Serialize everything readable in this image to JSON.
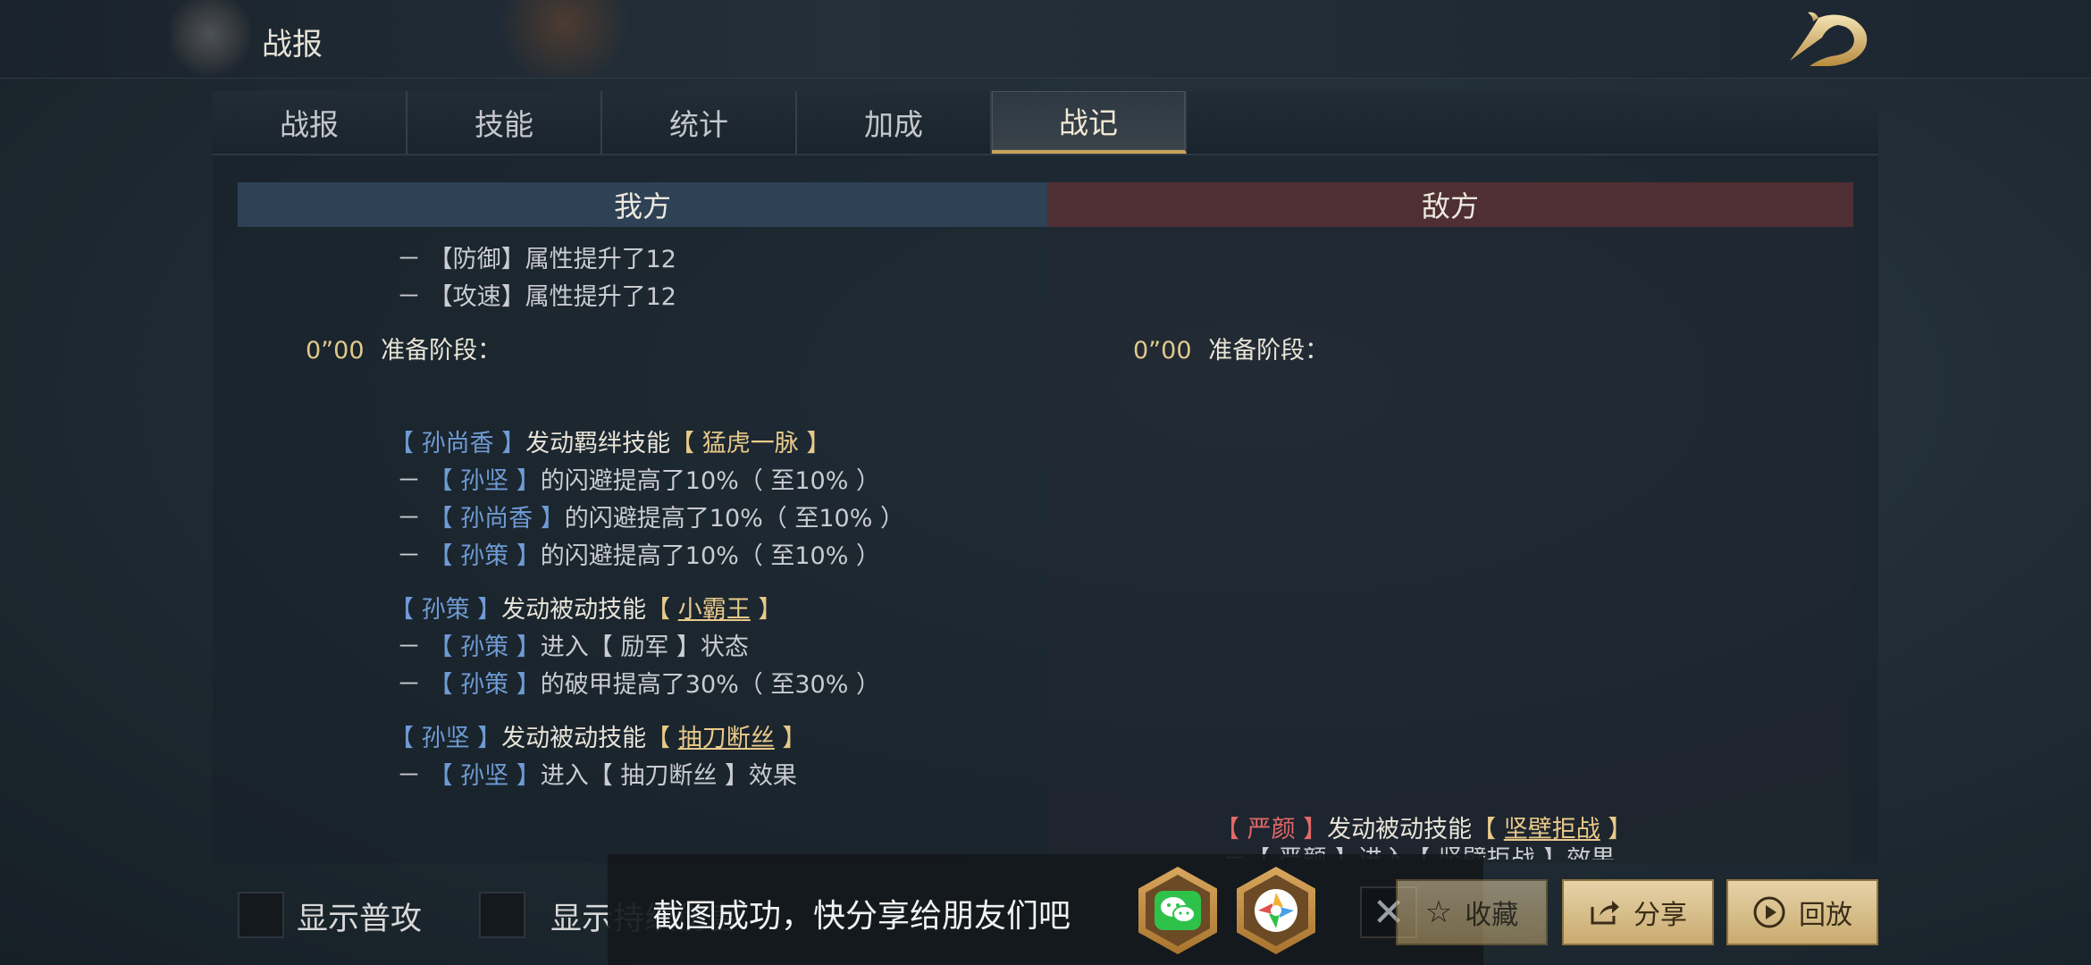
{
  "header": {
    "title": "战报"
  },
  "tabs": [
    {
      "label": "战报",
      "active": false
    },
    {
      "label": "技能",
      "active": false
    },
    {
      "label": "统计",
      "active": false
    },
    {
      "label": "加成",
      "active": false
    },
    {
      "label": "战记",
      "active": true
    }
  ],
  "sides": {
    "mine": "我方",
    "enemy": "敌方"
  },
  "my_log": {
    "buff1": {
      "dash": "－",
      "lb": "【",
      "stat": "防御",
      "rb": "】",
      "text": "属性提升了12"
    },
    "buff2": {
      "dash": "－",
      "lb": "【",
      "stat": "攻速",
      "rb": "】",
      "text": "属性提升了12"
    },
    "phase": {
      "time": "0”00",
      "label": "准备阶段："
    },
    "skill1": {
      "hero": "【 孙尚香 】",
      "action": "发动羁绊技能",
      "skill": "【 猛虎一脉 】",
      "effects": [
        {
          "dash": "－",
          "hero": "【 孙坚 】",
          "text": "的闪避提高了10%（ 至10% ）"
        },
        {
          "dash": "－",
          "hero": "【 孙尚香 】",
          "text": "的闪避提高了10%（ 至10% ）"
        },
        {
          "dash": "－",
          "hero": "【 孙策 】",
          "text": "的闪避提高了10%（ 至10% ）"
        }
      ]
    },
    "skill2": {
      "hero": "【 孙策 】",
      "action": "发动被动技能",
      "lb": "【 ",
      "skill": "小霸王",
      "rb": " 】",
      "effects": [
        {
          "dash": "－",
          "hero": "【 孙策 】",
          "text": "进入【 励军 】状态"
        },
        {
          "dash": "－",
          "hero": "【 孙策 】",
          "text": "的破甲提高了30%（ 至30% ）"
        }
      ]
    },
    "skill3": {
      "hero": "【 孙坚 】",
      "action": "发动被动技能",
      "lb": "【 ",
      "skill": "抽刀断丝",
      "rb": " 】",
      "effects": [
        {
          "dash": "－",
          "hero": "【 孙坚 】",
          "text": "进入【 抽刀断丝 】效果"
        }
      ]
    }
  },
  "enemy_log": {
    "phase": {
      "time": "0”00",
      "label": "准备阶段："
    },
    "skill1": {
      "hero": "【 严颜 】",
      "action": "发动被动技能",
      "lb": "【 ",
      "skill": "坚壁拒战",
      "rb": " 】"
    },
    "partial": "－【 严颜 】进入【 坚壁拒战 】效果"
  },
  "bottom": {
    "show_normal_attack": "显示普攻",
    "show_persist": "显示持续伤害",
    "toast": "截图成功，快分享给朋友们吧",
    "share_icons": [
      "wechat-icon",
      "moments-icon"
    ],
    "favorite": "收藏",
    "share": "分享",
    "replay": "回放"
  },
  "colors": {
    "accent_gold": "#c8a45c",
    "ally_blue": "#6f9bd4",
    "enemy_red": "#e0696a",
    "skill_gold": "#e8c98a"
  }
}
